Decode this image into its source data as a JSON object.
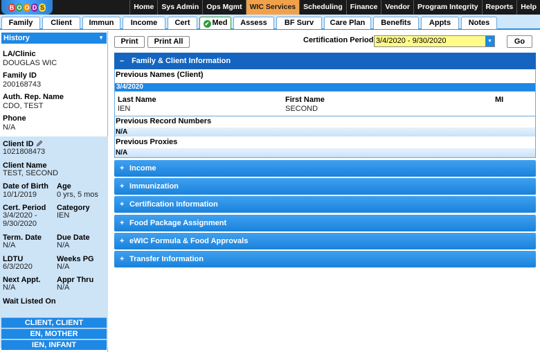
{
  "top_menu": [
    "Home",
    "Sys Admin",
    "Ops Mgmt",
    "WIC Services",
    "Scheduling",
    "Finance",
    "Vendor",
    "Program Integrity",
    "Reports",
    "Help"
  ],
  "active_menu": "WIC Services",
  "logo_letters": [
    "B",
    "O",
    "O",
    "D",
    "S"
  ],
  "tabs": [
    "Family",
    "Client",
    "Immun",
    "Income",
    "Cert",
    "Med",
    "Assess",
    "BF Surv",
    "Care Plan",
    "Benefits",
    "Appts",
    "Notes"
  ],
  "left": {
    "history_label": "History",
    "la_clinic_label": "LA/Clinic",
    "la_clinic_value": "DOUGLAS WIC",
    "family_id_label": "Family ID",
    "family_id_value": "200168743",
    "auth_rep_label": "Auth. Rep. Name",
    "auth_rep_value": "CDO, TEST",
    "phone_label": "Phone",
    "phone_value": "N/A",
    "client_id_label": "Client ID",
    "client_id_value": "1021808473",
    "client_name_label": "Client Name",
    "client_name_value": "TEST, SECOND",
    "dob_label": "Date of Birth",
    "dob_value": "10/1/2019",
    "age_label": "Age",
    "age_value": "0 yrs, 5 mos",
    "cert_period_label": "Cert. Period",
    "cert_period_value1": "3/4/2020 -",
    "cert_period_value2": "9/30/2020",
    "category_label": "Category",
    "category_value": "IEN",
    "term_label": "Term. Date",
    "term_value": "N/A",
    "due_label": "Due Date",
    "due_value": "N/A",
    "ldtu_label": "LDTU",
    "ldtu_value": "6/3/2020",
    "weeks_label": "Weeks PG",
    "weeks_value": "N/A",
    "next_appt_label": "Next Appt.",
    "next_appt_value": "N/A",
    "appr_label": "Appr Thru",
    "appr_value": "N/A",
    "wait_label": "Wait Listed On",
    "people": [
      "CLIENT, CLIENT",
      "EN, MOTHER",
      "IEN, INFANT"
    ]
  },
  "toolbar": {
    "print": "Print",
    "print_all": "Print All",
    "cert_label": "Certification Period:",
    "cert_value": "3/4/2020 - 9/30/2020",
    "go": "Go"
  },
  "family_section": {
    "title": "Family & Client Information",
    "toggle": "–",
    "prev_names_label": "Previous Names (Client)",
    "date": "3/4/2020",
    "col_last": "Last Name",
    "col_first": "First Name",
    "col_mi": "MI",
    "last_value": "IEN",
    "first_value": "SECOND",
    "prev_records_label": "Previous Record Numbers",
    "prev_records_value": "N/A",
    "prev_proxies_label": "Previous Proxies",
    "prev_proxies_value": "N/A"
  },
  "sections": [
    {
      "toggle": "+",
      "title": "Income"
    },
    {
      "toggle": "+",
      "title": "Immunization"
    },
    {
      "toggle": "+",
      "title": "Certification Information"
    },
    {
      "toggle": "+",
      "title": "Food Package Assignment"
    },
    {
      "toggle": "+",
      "title": "eWIC Formula & Food Approvals"
    },
    {
      "toggle": "+",
      "title": "Transfer Information"
    }
  ]
}
